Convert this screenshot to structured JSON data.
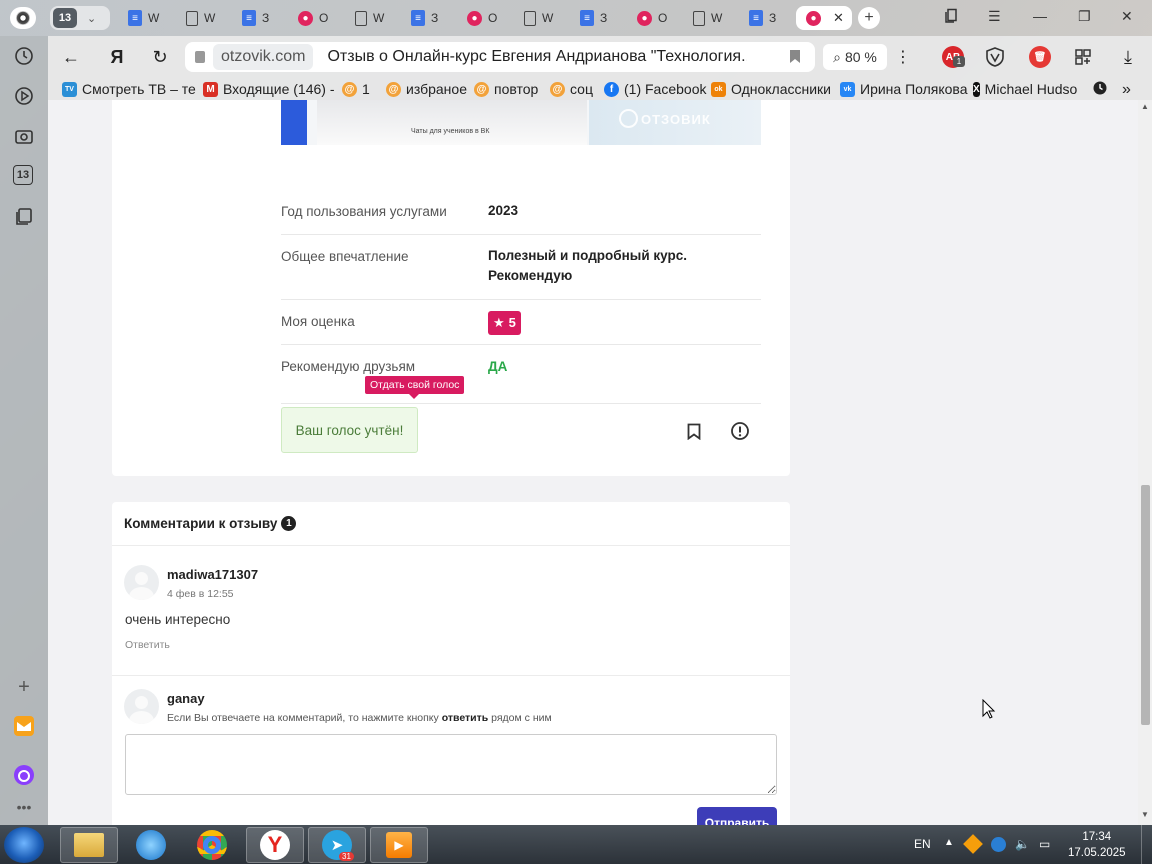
{
  "tabs": {
    "group_count": "13",
    "items": [
      {
        "kind": "gdoc",
        "label": "W"
      },
      {
        "kind": "page",
        "label": "W"
      },
      {
        "kind": "gdoc",
        "label": "З"
      },
      {
        "kind": "otz",
        "label": "О"
      },
      {
        "kind": "page",
        "label": "W"
      },
      {
        "kind": "gdoc",
        "label": "З"
      },
      {
        "kind": "otz",
        "label": "О"
      },
      {
        "kind": "page",
        "label": "W"
      },
      {
        "kind": "gdoc",
        "label": "З"
      },
      {
        "kind": "otz",
        "label": "О"
      },
      {
        "kind": "page",
        "label": "W"
      },
      {
        "kind": "gdoc",
        "label": "З"
      }
    ]
  },
  "nav": {
    "ya_label": "Я",
    "domain": "otzovik.com",
    "title": "Отзыв о Онлайн-курс Евгения Андрианова \"Технология...",
    "zoom": "80 %",
    "ext_badge": "1"
  },
  "bookmarks": [
    {
      "label": "Смотреть ТВ – те",
      "color": "#2b8fd6",
      "glyph": "TV"
    },
    {
      "label": "Входящие (146) -",
      "color": "#d93025",
      "glyph": "M"
    },
    {
      "label": "1",
      "color": "#f2a23a",
      "glyph": "@"
    },
    {
      "label": "избраное",
      "color": "#f2a23a",
      "glyph": "@"
    },
    {
      "label": "повтор",
      "color": "#f2a23a",
      "glyph": "@"
    },
    {
      "label": "соц",
      "color": "#f2a23a",
      "glyph": "@"
    },
    {
      "label": "(1) Facebook",
      "color": "#1877f2",
      "glyph": "f"
    },
    {
      "label": "Одноклассники",
      "color": "#ee8208",
      "glyph": "ok"
    },
    {
      "label": "Ирина Полякова",
      "color": "#2787f5",
      "glyph": "vk"
    },
    {
      "label": "Michael Hudso",
      "color": "#111111",
      "glyph": "X"
    }
  ],
  "review": {
    "photo_caption": "Чаты для учеников в ВК",
    "watermark": "ОТЗОВИК",
    "props": [
      {
        "label": "Год пользования услугами",
        "value": "2023"
      },
      {
        "label": "Общее впечатление",
        "value": "Полезный и подробный курс. Рекомендую"
      },
      {
        "label": "Моя оценка",
        "value": "5"
      },
      {
        "label": "Рекомендую друзьям",
        "value": "ДА"
      }
    ],
    "tooltip": "Отдать свой голос",
    "vote_text": "Ваш голос учтён!"
  },
  "comments": {
    "title": "Комментарии к отзыву",
    "count": "1",
    "items": [
      {
        "user": "madiwa171307",
        "date": "4 фев в 12:55",
        "text": "очень интересно",
        "reply": "Ответить"
      }
    ],
    "current_user": "ganay",
    "hint_before": "Если Вы отвечаете на комментарий, то нажмите кнопку",
    "hint_bold": "ответить",
    "hint_after": "рядом с ним",
    "send_label": "Отправить"
  },
  "taskbar": {
    "lang": "EN",
    "telegram_badge": "31",
    "time": "17:34",
    "date": "17.05.2025"
  }
}
